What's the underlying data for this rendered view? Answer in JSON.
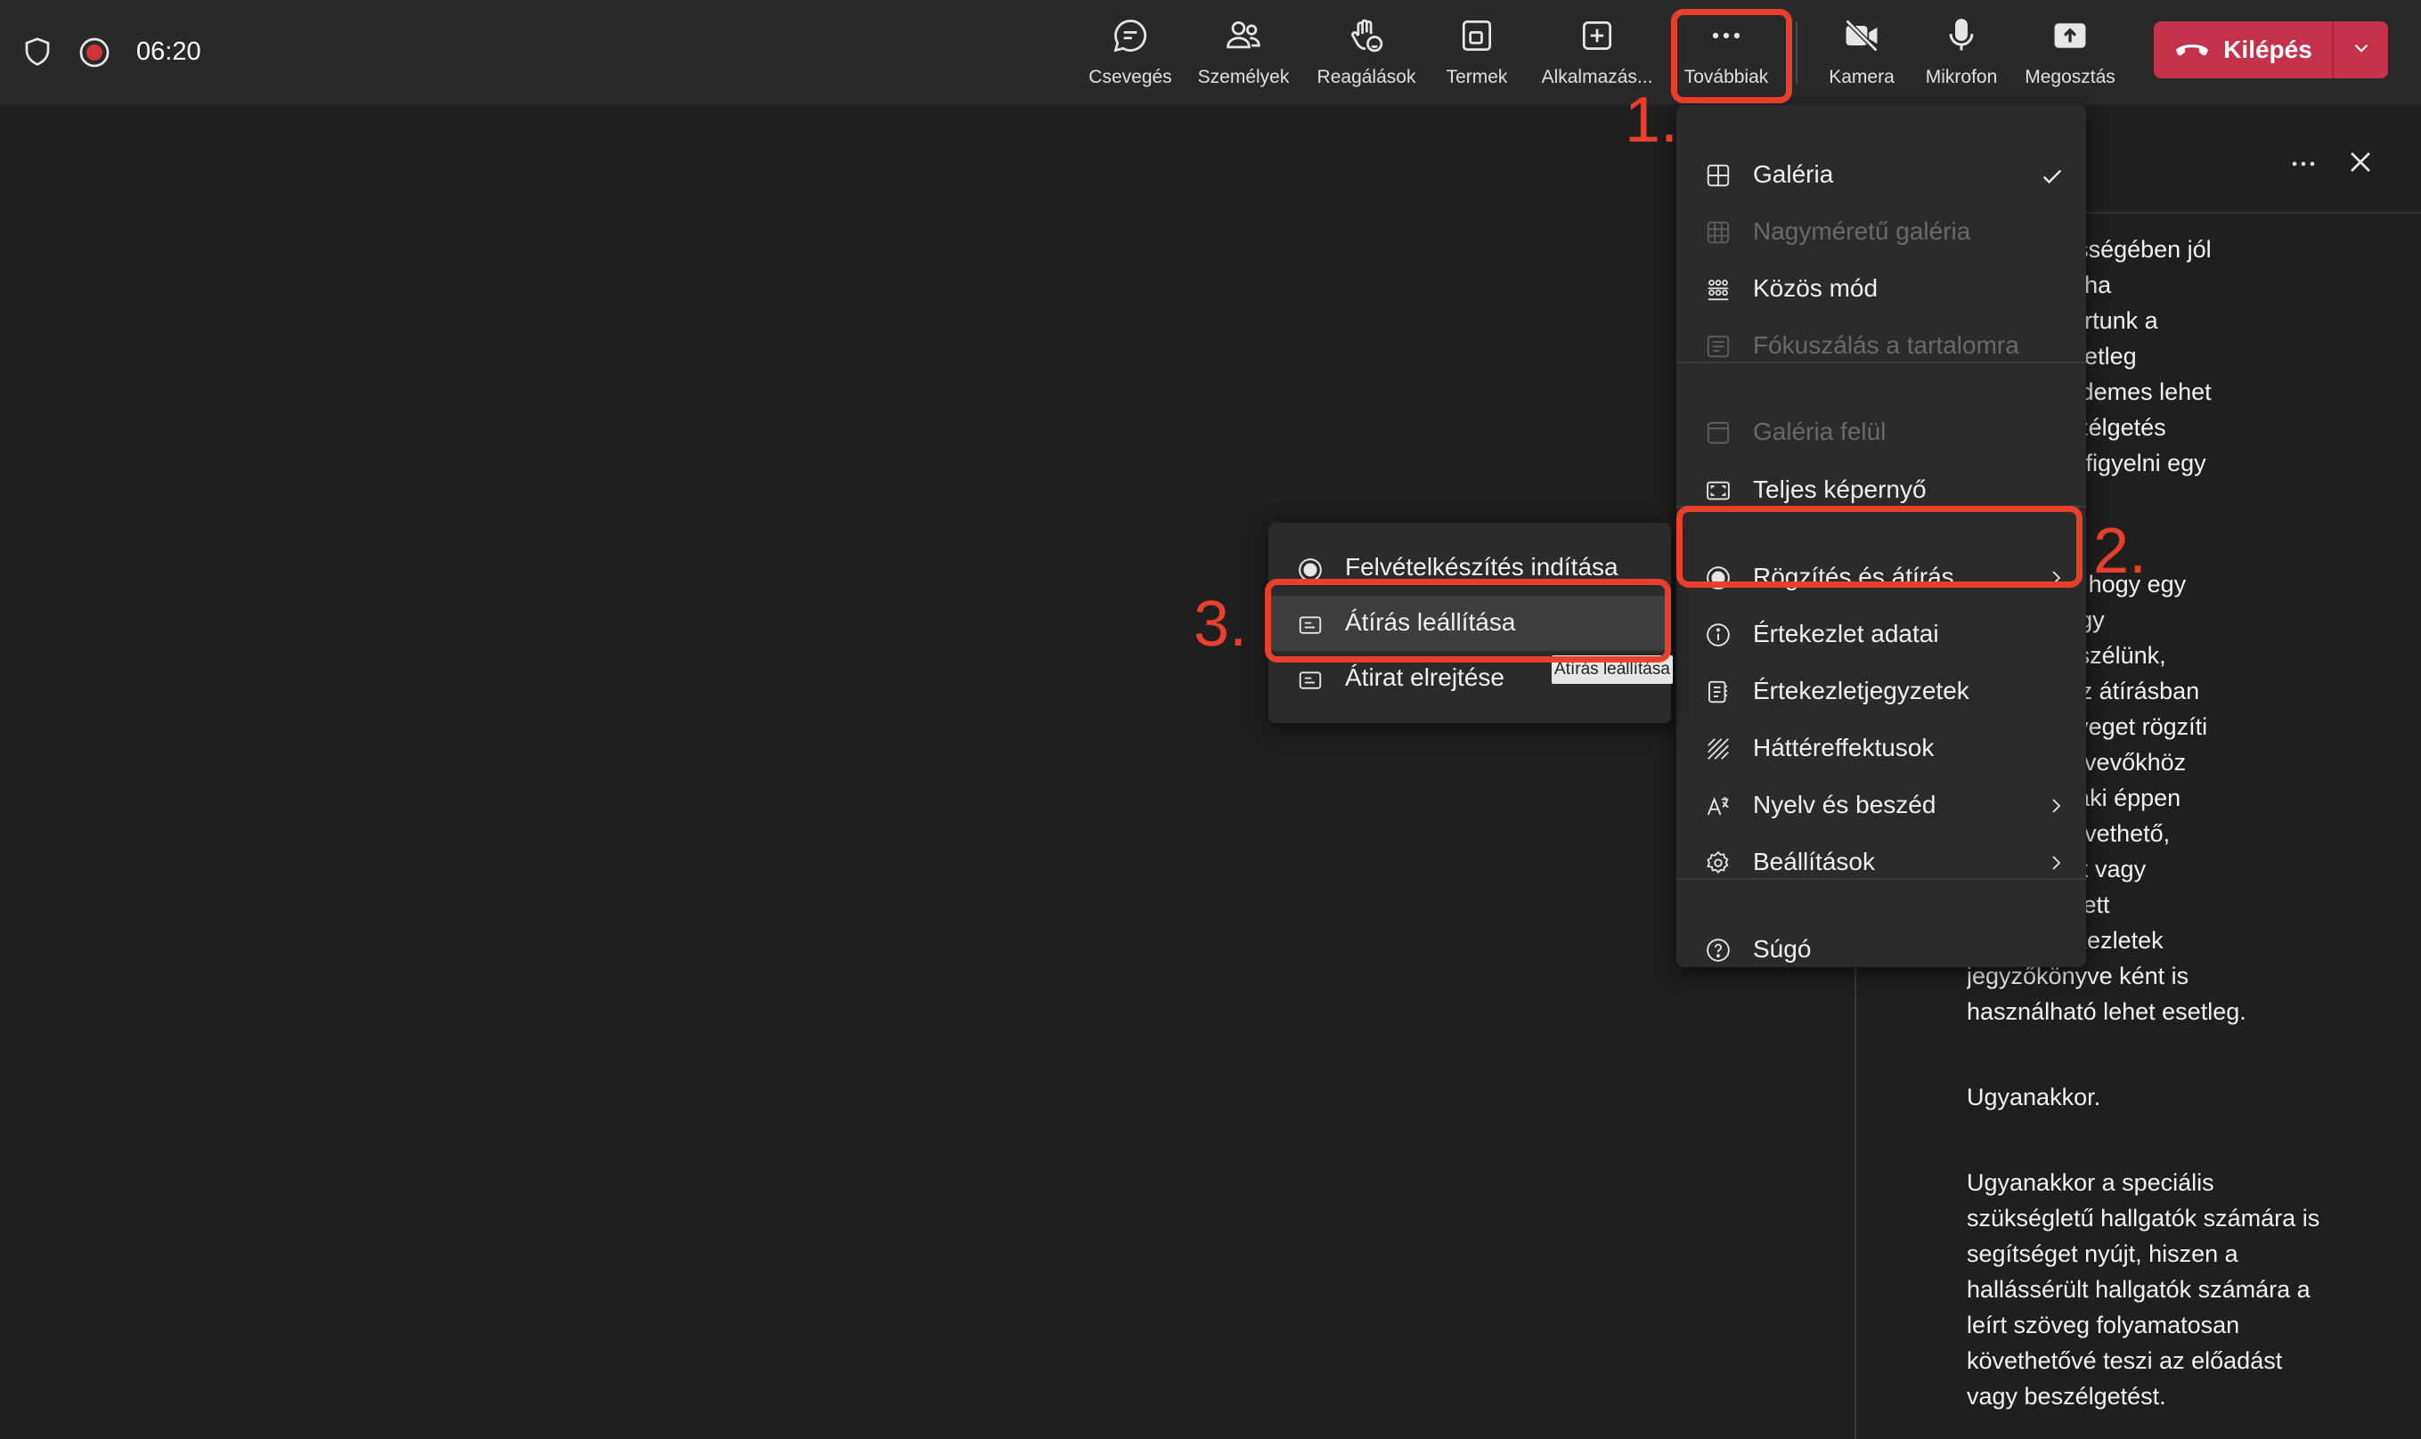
{
  "status": {
    "timer": "06:20"
  },
  "toolbar": {
    "items": [
      {
        "label": "Csevegés",
        "icon": "chat-icon"
      },
      {
        "label": "Személyek",
        "icon": "people-icon"
      },
      {
        "label": "Reagálások",
        "icon": "raise-hand-icon"
      },
      {
        "label": "Termek",
        "icon": "rooms-icon"
      },
      {
        "label": "Alkalmazás...",
        "icon": "apps-icon"
      },
      {
        "label": "Továbbiak",
        "icon": "more-icon"
      },
      {
        "label": "Kamera",
        "icon": "camera-off-icon"
      },
      {
        "label": "Mikrofon",
        "icon": "microphone-icon"
      },
      {
        "label": "Megosztás",
        "icon": "share-icon"
      }
    ],
    "leave_label": "Kilépés"
  },
  "more_menu": {
    "items": [
      {
        "label": "Galéria",
        "icon": "gallery-icon",
        "checked": true
      },
      {
        "label": "Nagyméretű galéria",
        "icon": "large-gallery-icon",
        "disabled": true
      },
      {
        "label": "Közös mód",
        "icon": "together-mode-icon"
      },
      {
        "label": "Fókuszálás a tartalomra",
        "icon": "focus-content-icon",
        "disabled": true
      },
      {
        "label": "Galéria felül",
        "icon": "gallery-top-icon",
        "disabled": true
      },
      {
        "label": "Teljes képernyő",
        "icon": "fullscreen-icon"
      },
      {
        "label": "Rögzítés és átírás",
        "icon": "record-icon",
        "submenu": true
      },
      {
        "label": "Értekezlet adatai",
        "icon": "info-icon"
      },
      {
        "label": "Értekezletjegyzetek",
        "icon": "notes-icon"
      },
      {
        "label": "Háttéreffektusok",
        "icon": "background-effects-icon"
      },
      {
        "label": "Nyelv és beszéd",
        "icon": "language-icon",
        "submenu": true
      },
      {
        "label": "Beállítások",
        "icon": "settings-icon",
        "submenu": true
      },
      {
        "label": "Súgó",
        "icon": "help-icon"
      }
    ]
  },
  "submenu": {
    "items": [
      {
        "label": "Felvételkészítés indítása",
        "icon": "record-start-icon"
      },
      {
        "label": "Átírás leállítása",
        "icon": "transcript-icon"
      },
      {
        "label": "Átirat elrejtése",
        "icon": "transcript-hide-icon"
      }
    ],
    "tooltip": "Átírás leállítása"
  },
  "annotations": {
    "step1": "1.",
    "step2": "2.",
    "step3": "3."
  },
  "transcript": {
    "paragraphs": [
      ", de összességében jól\ntó, ha szó, ha\nszünetet tartunk a\nn, akkor esetleg\nalakítja. Érdemes lehet\nni egy beszélgetés\nagy erre is figyelni egy\nés közben.",
      "ól van szó, hogy egy\nrán vagy egy\nközben beszélünk,\nrendszer az átírásban\nangzó szöveget rögzíti\nhoz a résztvevőkhöz\nszöveget, aki éppen\n nyomon követhető,\n, amit egyik vagy\ntvevő említett\nEz az értekezletek\njegyzőkönyve ként is\nhasználható lehet esetleg.",
      "Ugyanakkor.",
      "Ugyanakkor a speciális\nszükségletű hallgatók számára is\nsegítséget nyújt, hiszen a\nhallássérült hallgatók számára a\nleírt szöveg folyamatosan\nkövethetővé teszi az előadást\nvagy beszélgetést."
    ]
  }
}
